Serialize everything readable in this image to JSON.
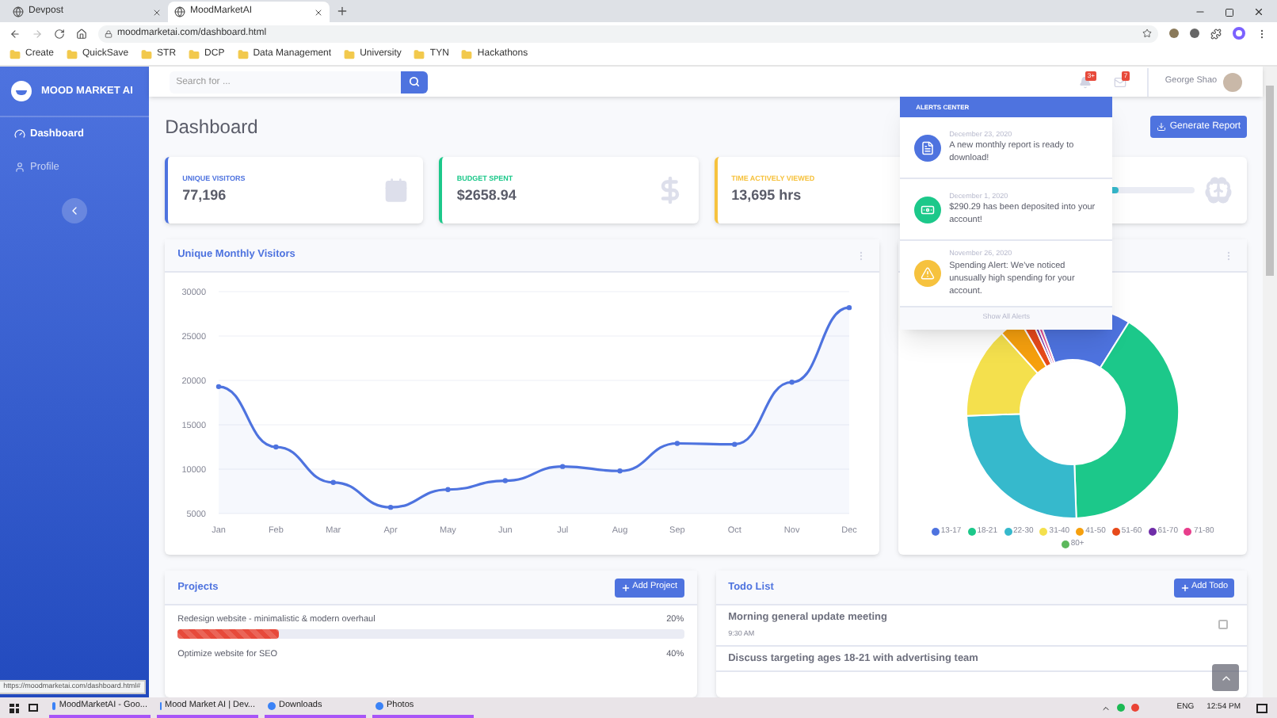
{
  "browser": {
    "tabs": [
      {
        "title": "Devpost",
        "selected": false
      },
      {
        "title": "MoodMarketAI",
        "selected": true
      }
    ],
    "address": "moodmarketai.com/dashboard.html",
    "bookmarks": [
      "Create",
      "QuickSave",
      "STR",
      "DCP",
      "Data Management",
      "University",
      "TYN",
      "Hackathons"
    ],
    "status_url": "https://moodmarketai.com/dashboard.html#"
  },
  "sidebar": {
    "brand": "MOOD MARKET AI",
    "items": [
      {
        "label": "Dashboard",
        "selected": true
      },
      {
        "label": "Profile",
        "selected": false
      }
    ]
  },
  "topbar": {
    "search_placeholder": "Search for ...",
    "alerts_badge": "3+",
    "messages_badge": "7",
    "user": "George Shao"
  },
  "page_title": "Dashboard",
  "report_button": "Generate Report",
  "stats": [
    {
      "kind": "calendar",
      "label": "UNIQUE VISITORS",
      "value": "77,196",
      "color": "#4e73df"
    },
    {
      "kind": "dollar",
      "label": "BUDGET SPENT",
      "value": "$2658.94",
      "color": "#1cc88a"
    },
    {
      "kind": "plain",
      "label": "TIME ACTIVELY VIEWED",
      "value": "13,695 hrs",
      "color": "#f6c23e"
    },
    {
      "kind": "progress",
      "color": "#36b9cc",
      "level": 0.6
    }
  ],
  "line_card": {
    "title": "Unique Monthly Visitors",
    "chart_data": {
      "type": "area",
      "categories": [
        "Jan",
        "Feb",
        "Mar",
        "Apr",
        "May",
        "Jun",
        "Jul",
        "Aug",
        "Sep",
        "Oct",
        "Nov",
        "Dec"
      ],
      "grid": true,
      "series": [
        {
          "color": "#4e73df",
          "values": [
            19300,
            12500,
            8500,
            5700,
            7700,
            8700,
            10300,
            9800,
            12900,
            12800,
            19800,
            28200
          ]
        }
      ],
      "ylim": [
        5000,
        30000
      ],
      "yticks": [
        5000,
        10000,
        15000,
        20000,
        25000,
        30000
      ]
    }
  },
  "donut_card": {
    "legend": [
      {
        "label": "13-17",
        "color": "#4e73df"
      },
      {
        "label": "18-21",
        "color": "#1cc88a"
      },
      {
        "label": "22-30",
        "color": "#36b9cc"
      },
      {
        "label": "31-40",
        "color": "#f4e04d"
      },
      {
        "label": "41-50",
        "color": "#f6a00e"
      },
      {
        "label": "51-60",
        "color": "#e74a1b"
      },
      {
        "label": "61-70",
        "color": "#6f2da8"
      },
      {
        "label": "71-80",
        "color": "#e83e8c"
      },
      {
        "label": "80+",
        "color": "#5cb85c"
      }
    ]
  },
  "alerts": {
    "title": "ALERTS CENTER",
    "items": [
      {
        "kind": "file",
        "date": "December 23, 2020",
        "text": "A new monthly report is ready to download!",
        "color": "#4e73df"
      },
      {
        "kind": "money",
        "date": "December 1, 2020",
        "text": "$290.29 has been deposited into your account!",
        "color": "#1cc88a"
      },
      {
        "kind": "warning",
        "date": "November 26, 2020",
        "text": "Spending Alert: We've noticed unusually high spending for your account.",
        "color": "#f6c23e"
      }
    ],
    "footer": "Show All Alerts"
  },
  "projects": {
    "title": "Projects",
    "button": "Add Project",
    "items": [
      {
        "name": "Redesign website - minimalistic & modern overhaul",
        "percent": "20%",
        "level": 0.2,
        "color": "#e74a3b"
      },
      {
        "name": "Optimize website for SEO",
        "percent": "40%"
      }
    ]
  },
  "todos": {
    "title": "Todo List",
    "button": "Add Todo",
    "items": [
      {
        "task": "Morning general update meeting",
        "time": "9:30 AM",
        "checked": false
      },
      {
        "task": "Discuss targeting ages 18-21 with advertising team"
      }
    ]
  },
  "taskbar": {
    "apps": [
      "MoodMarketAI - Goo...",
      "Mood Market AI | Dev...",
      "Downloads",
      "Photos"
    ],
    "language": "ENG",
    "time": "12:54 PM"
  }
}
